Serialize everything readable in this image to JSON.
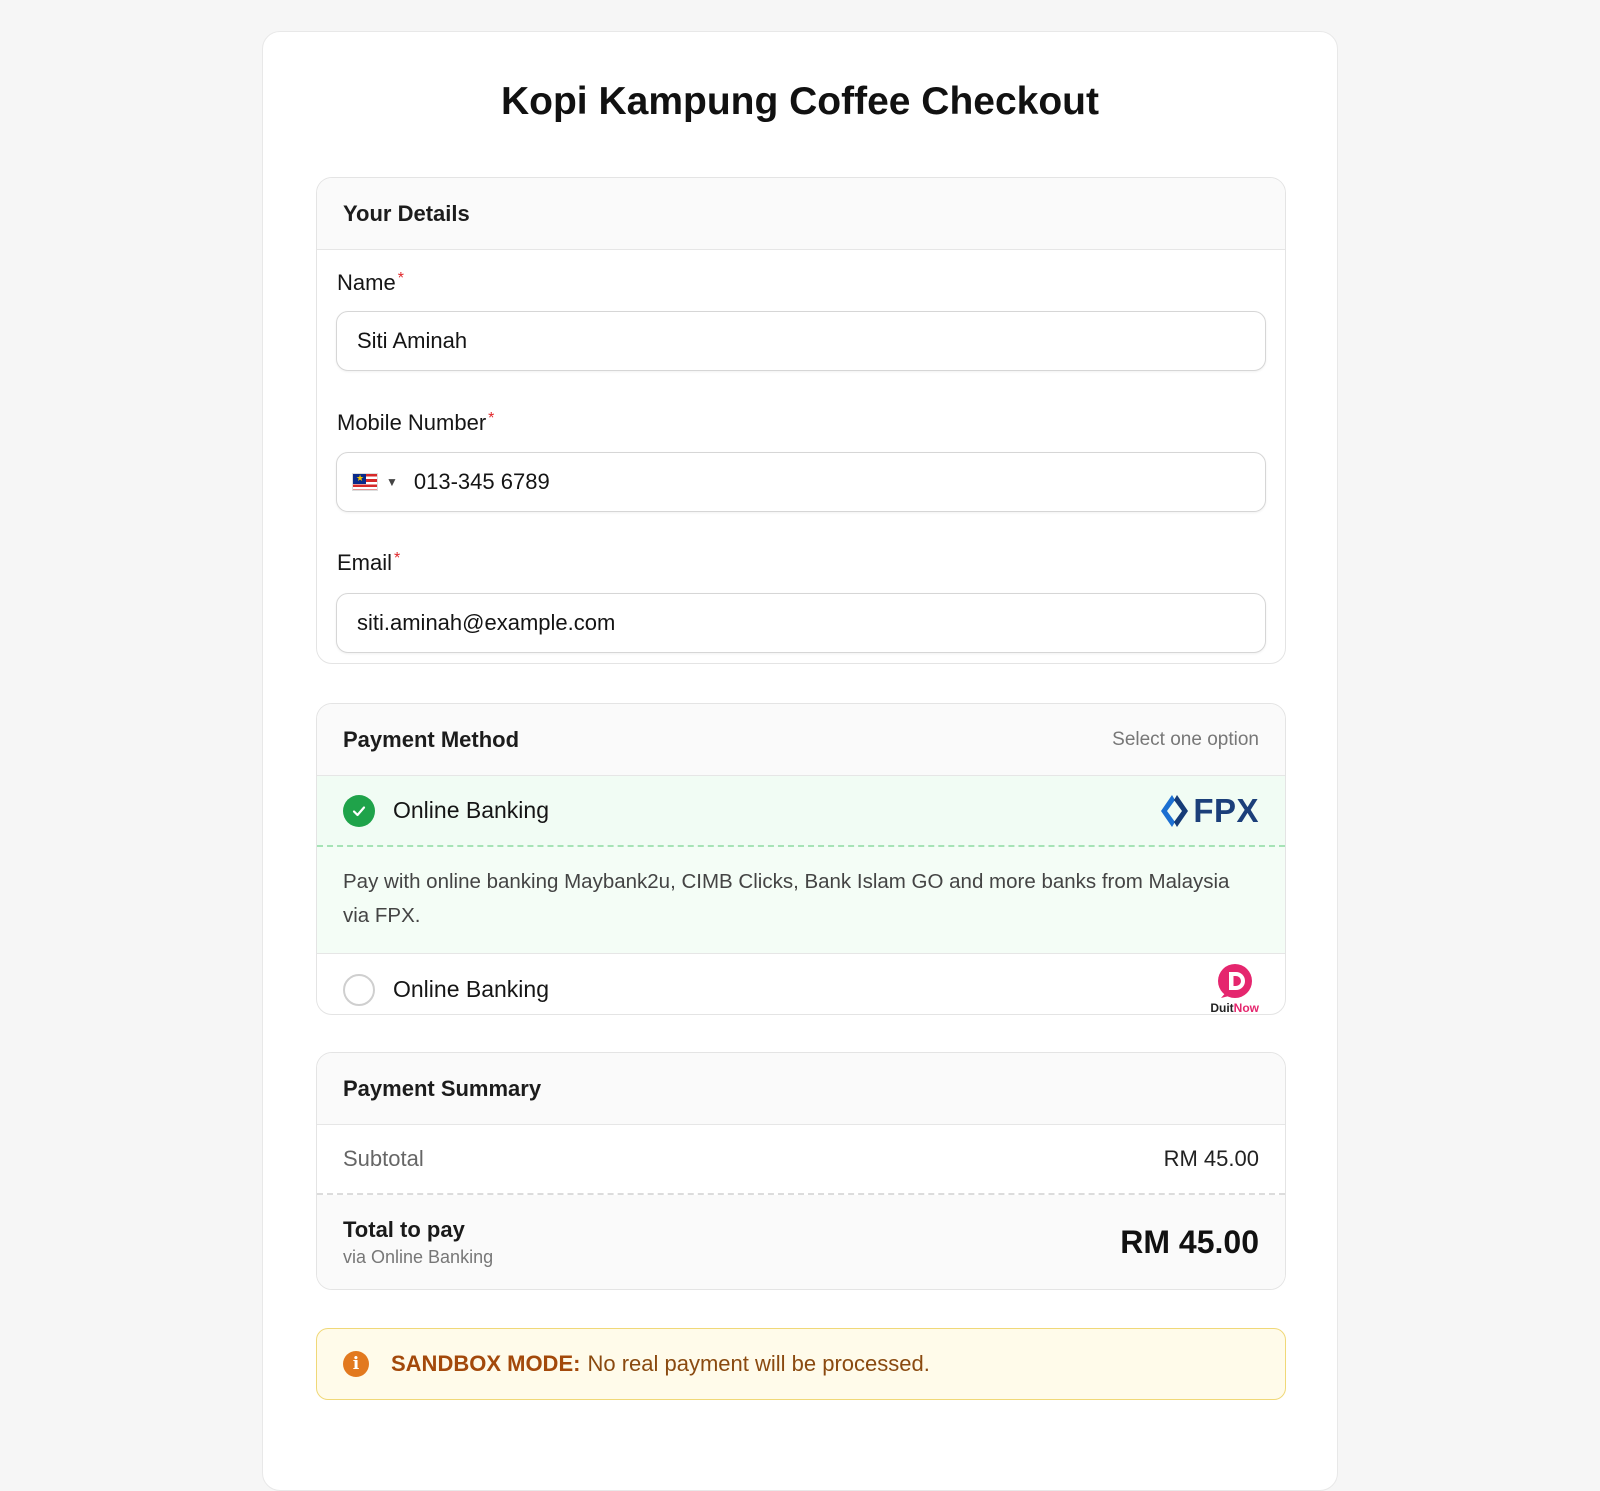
{
  "title": "Kopi Kampung Coffee Checkout",
  "details": {
    "heading": "Your Details",
    "required_mark": "*",
    "name": {
      "label": "Name",
      "value": "Siti Aminah"
    },
    "mobile": {
      "label": "Mobile Number",
      "value": "013-345 6789",
      "country_flag": "malaysia-flag"
    },
    "email": {
      "label": "Email",
      "value": "siti.aminah@example.com"
    }
  },
  "payment": {
    "heading": "Payment Method",
    "hint": "Select one option",
    "options": [
      {
        "label": "Online Banking",
        "selected": true,
        "logo_text": "FPX",
        "description": "Pay with online banking Maybank2u, CIMB Clicks, Bank Islam GO and more banks from Malaysia via FPX."
      },
      {
        "label": "Online Banking",
        "selected": false,
        "logo_text_1": "Duit",
        "logo_text_2": "Now"
      }
    ],
    "colors": {
      "selected": "#1fa34a",
      "fpx": "#1c3f7a",
      "duitnow": "#e5266e"
    }
  },
  "summary": {
    "heading": "Payment Summary",
    "subtotal_label": "Subtotal",
    "subtotal_value": "RM 45.00",
    "total_label": "Total to pay",
    "total_sub": "via Online Banking",
    "total_value": "RM 45.00"
  },
  "sandbox": {
    "bold": "SANDBOX MODE:",
    "text": "No real payment will be processed."
  }
}
